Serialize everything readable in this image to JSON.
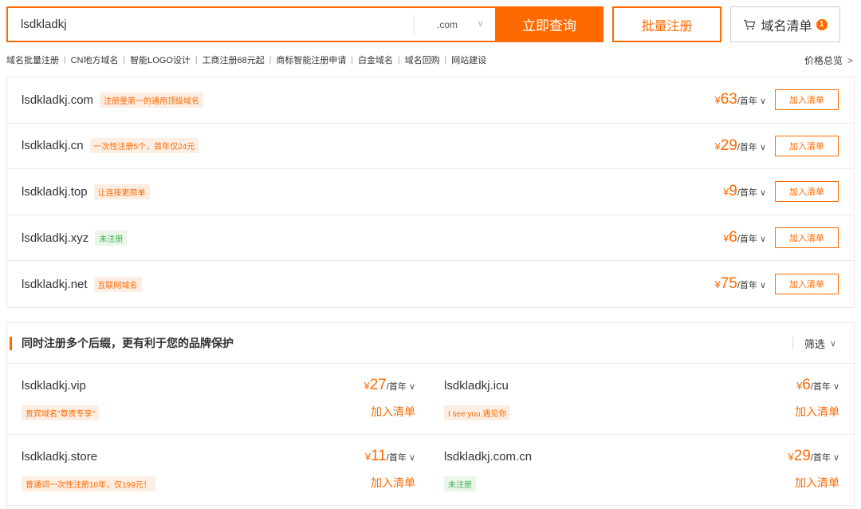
{
  "search": {
    "query": "lsdkladkj",
    "suffix": ".com",
    "submit_label": "立即查询"
  },
  "batch_register_label": "批量注册",
  "cart": {
    "label": "域名清单",
    "count": "1"
  },
  "quick_links": [
    "域名批量注册",
    "CN地方域名",
    "智能LOGO设计",
    "工商注册68元起",
    "商标智能注册申请",
    "白金域名",
    "域名回购",
    "网站建设"
  ],
  "price_overview": "价格总览",
  "results": [
    {
      "domain": "lsdkladkj.com",
      "tag": "注册量第一的通用顶级域名",
      "tag_color": "orange",
      "yen": "¥",
      "price": "63",
      "unit": "/首年",
      "add_label": "加入清单"
    },
    {
      "domain": "lsdkladkj.cn",
      "tag": "一次性注册5个，首年仅24元",
      "tag_color": "orange",
      "yen": "¥",
      "price": "29",
      "unit": "/首年",
      "add_label": "加入清单"
    },
    {
      "domain": "lsdkladkj.top",
      "tag": "让连接更简单",
      "tag_color": "orange",
      "yen": "¥",
      "price": "9",
      "unit": "/首年",
      "add_label": "加入清单"
    },
    {
      "domain": "lsdkladkj.xyz",
      "tag": "未注册",
      "tag_color": "green",
      "yen": "¥",
      "price": "6",
      "unit": "/首年",
      "add_label": "加入清单"
    },
    {
      "domain": "lsdkladkj.net",
      "tag": "互联网域名",
      "tag_color": "orange",
      "yen": "¥",
      "price": "75",
      "unit": "/首年",
      "add_label": "加入清单"
    }
  ],
  "recommend": {
    "title": "同时注册多个后缀，更有利于您的品牌保护",
    "filter_label": "筛选",
    "items": [
      {
        "domain": "lsdkladkj.vip",
        "tag": "贵宾域名\"尊贵专享\"",
        "tag_color": "orange",
        "yen": "¥",
        "price": "27",
        "unit": "/首年",
        "add_label": "加入清单"
      },
      {
        "domain": "lsdkladkj.icu",
        "tag": "I see you.遇见你",
        "tag_color": "orange",
        "yen": "¥",
        "price": "6",
        "unit": "/首年",
        "add_label": "加入清单"
      },
      {
        "domain": "lsdkladkj.store",
        "tag": "普通词一次性注册10年，仅199元！",
        "tag_color": "orange",
        "yen": "¥",
        "price": "11",
        "unit": "/首年",
        "add_label": "加入清单"
      },
      {
        "domain": "lsdkladkj.com.cn",
        "tag": "未注册",
        "tag_color": "green",
        "yen": "¥",
        "price": "29",
        "unit": "/首年",
        "add_label": "加入清单"
      }
    ]
  },
  "colors": {
    "accent": "#ff6a00",
    "tag_bg": "#fdeee4",
    "green": "#3fb04e",
    "green_bg": "#e9f6ea"
  },
  "icons": {
    "cart": "cart-icon",
    "dropdown": "chevron-down-icon",
    "more": "chevron-right-icon"
  }
}
